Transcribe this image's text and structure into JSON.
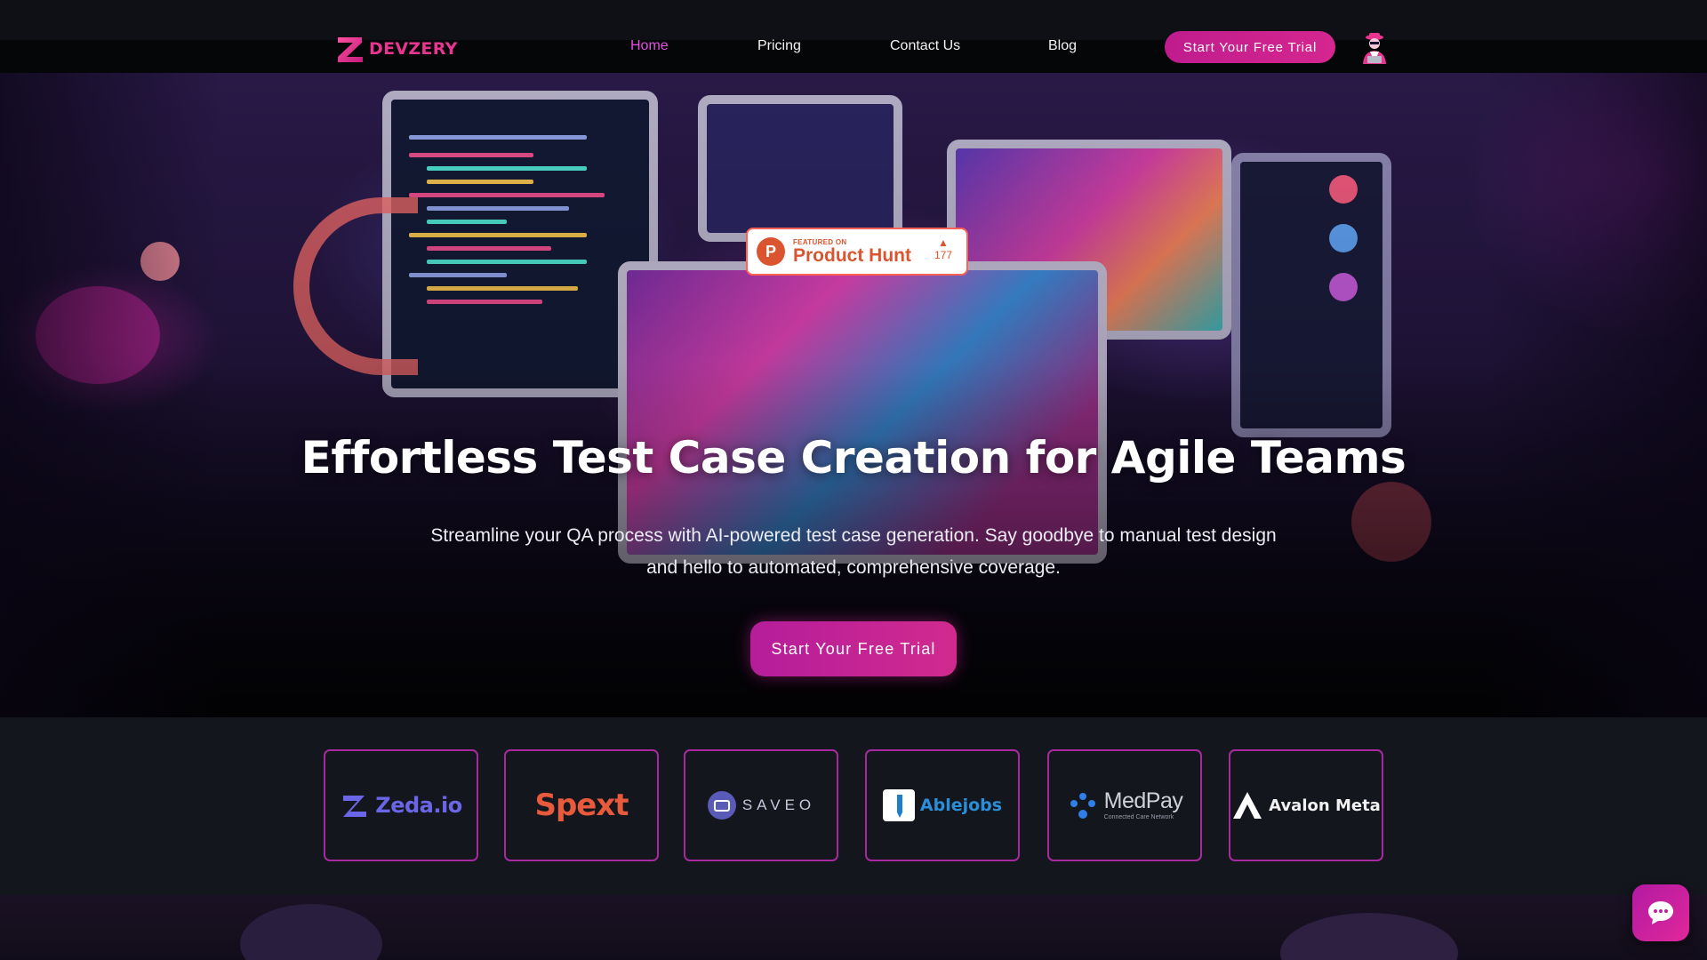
{
  "brand": {
    "name": "DEVZERY"
  },
  "nav": {
    "items": [
      {
        "label": "Home",
        "active": true
      },
      {
        "label": "Pricing",
        "active": false
      },
      {
        "label": "Contact Us",
        "active": false
      },
      {
        "label": "Blog",
        "active": false
      }
    ],
    "cta_label": "Start Your Free Trial",
    "avatar_icon": "user-avatar-icon"
  },
  "product_hunt": {
    "small_label": "FEATURED ON",
    "big_label": "Product Hunt",
    "logo_letter": "P",
    "arrow": "▲",
    "votes": "177"
  },
  "hero": {
    "title": "Effortless Test Case Creation for Agile Teams",
    "subtitle": "Streamline your QA process with AI-powered test case generation. Say goodbye to manual test design and hello to automated, comprehensive coverage.",
    "cta_label": "Start Your Free Trial"
  },
  "partners": [
    {
      "name": "Zeda.io"
    },
    {
      "name": "Spext"
    },
    {
      "name": "SAVEO"
    },
    {
      "name": "Ablejobs"
    },
    {
      "name": "MedPay",
      "tagline": "Connected Care Network"
    },
    {
      "name": "Avalon Meta"
    }
  ],
  "colors": {
    "accent": "#d5268f",
    "active_nav": "#e04fe0",
    "card_border": "#a8299f",
    "background": "#0d0f15"
  },
  "chat": {
    "icon": "chat-bubble-icon"
  }
}
